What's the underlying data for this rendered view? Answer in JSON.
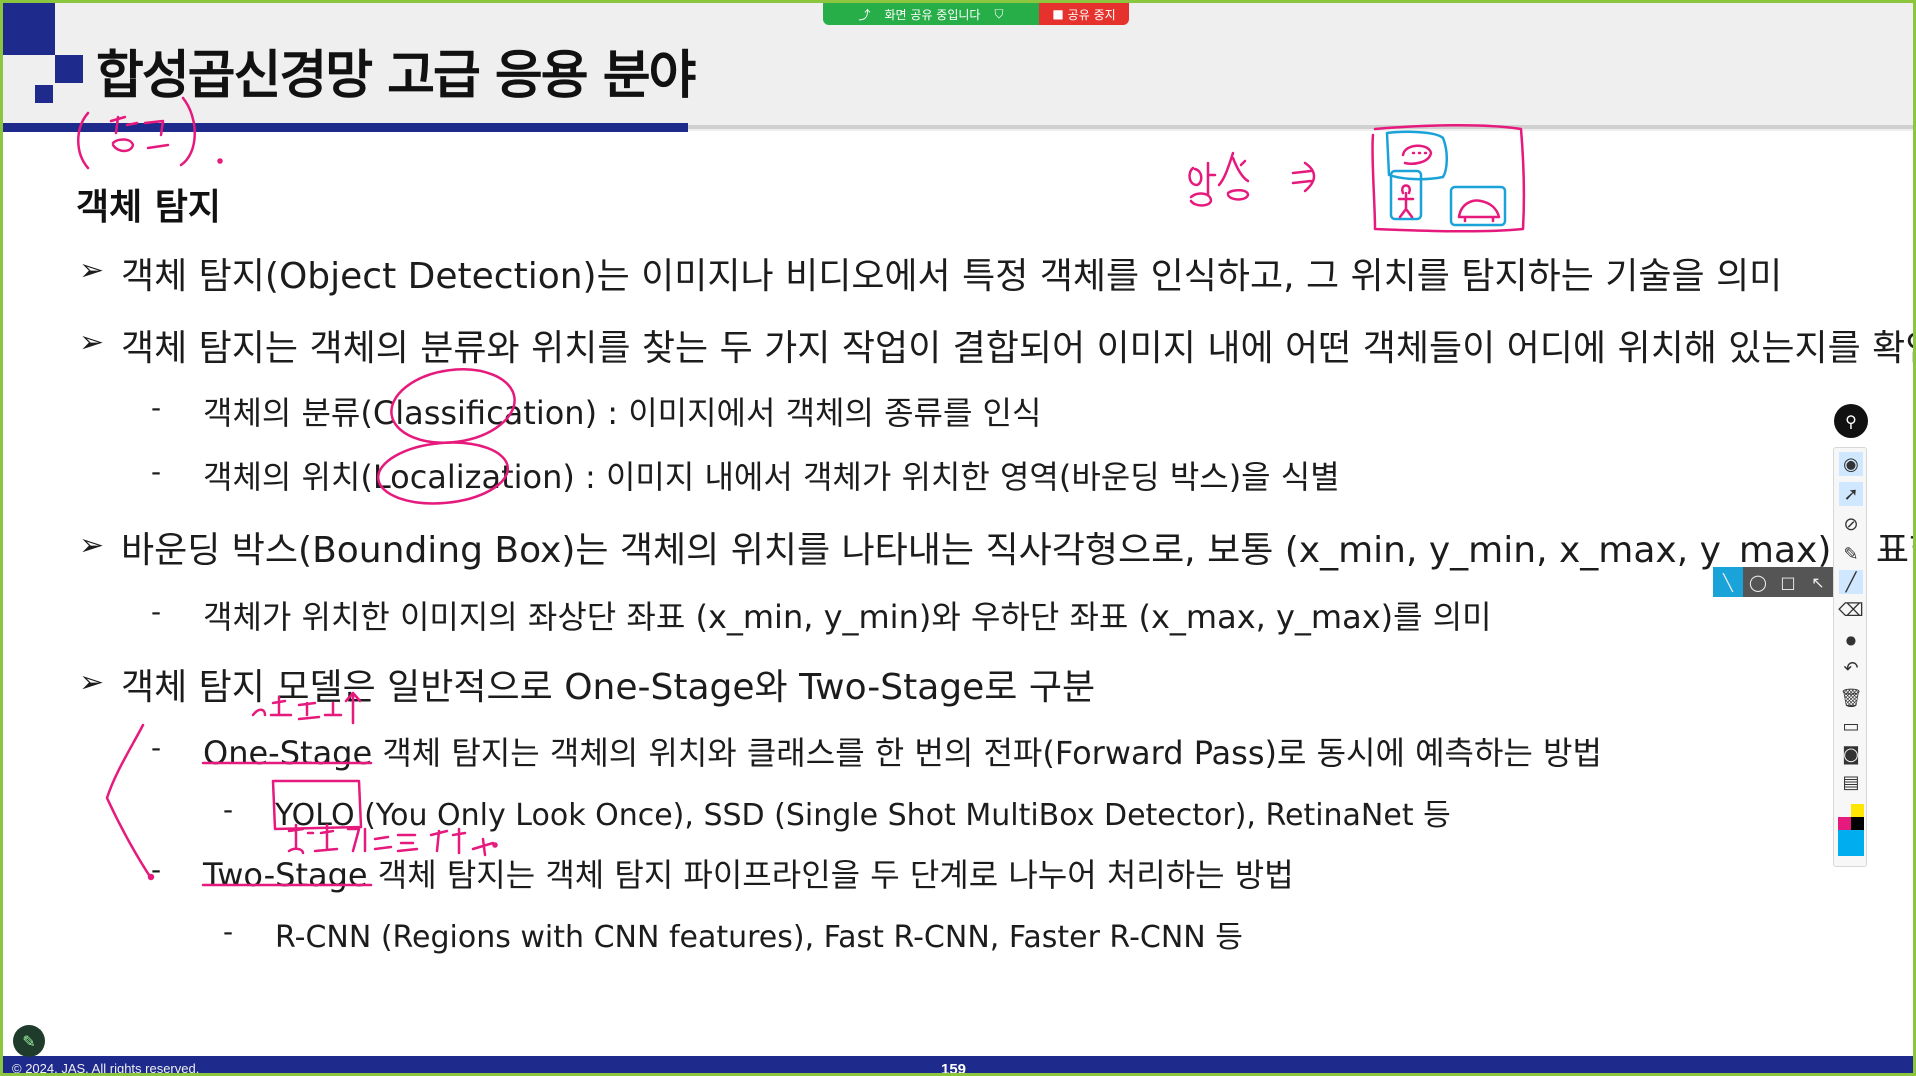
{
  "share_bar": {
    "status_text": "화면 공유 중입니다",
    "stop_label": "공유 중지",
    "colors": {
      "status_bg": "#27ae48",
      "stop_bg": "#e5322d"
    }
  },
  "slide": {
    "title": "합성곱신경망 고급 응용 분야",
    "section_title": "객체 탐지",
    "bullets": [
      "객체 탐지(Object Detection)는 이미지나 비디오에서 특정 객체를 인식하고, 그 위치를 탐지하는 기술을 의미",
      "객체 탐지는 객체의 분류와 위치를 찾는 두 가지 작업이 결합되어 이미지 내에 어떤 객체들이 어디에 위치해 있는지를 확인함",
      "바운딩 박스(Bounding Box)는 객체의 위치를 나타내는 직사각형으로, 보통 (x_min, y_min, x_max, y_max)로 표현",
      "객체 탐지 모델은 일반적으로 One-Stage와 Two-Stage로 구분"
    ],
    "sub_bullets": [
      "객체의 분류(Classification) : 이미지에서 객체의 종류를 인식",
      "객체의 위치(Localization) : 이미지 내에서 객체가 위치한 영역(바운딩 박스)을 식별",
      "객체가 위치한 이미지의 좌상단 좌표 (x_min, y_min)와 우하단 좌표 (x_max, y_max)를 의미",
      "One-Stage 객체 탐지는 객체의 위치와 클래스를 한 번의 전파(Forward Pass)로 동시에 예측하는 방법",
      "Two-Stage 객체 탐지는 객체 탐지 파이프라인을 두 단계로 나누어 처리하는 방법"
    ],
    "sub_sub_bullets": [
      "YOLO (You Only Look Once), SSD (Single Shot MultiBox Detector), RetinaNet 등",
      "R-CNN (Regions with CNN features), Fast R-CNN, Faster R-CNN 등"
    ],
    "bullet_marker": "➢",
    "dash_marker": "-"
  },
  "annotations": {
    "ink_color": "#e6197d",
    "handwritten": [
      "(참고)",
      "영상 ⇒",
      "속도↑",
      "실시간으로 탐지"
    ]
  },
  "toolbar": {
    "icons": [
      "pin-icon",
      "eye-icon",
      "pointer-icon",
      "laser-off-icon",
      "highlighter-icon",
      "pen-icon",
      "eraser-icon",
      "dot-icon",
      "undo-icon",
      "trash-icon",
      "whiteboard-icon",
      "camera-icon",
      "clipboard-icon",
      "color-palette"
    ],
    "palette": [
      "#ffe600",
      "#e6197d",
      "#000000",
      "#00aeef"
    ]
  },
  "footer": {
    "copyright": "© 2024. JAS. All rights reserved.",
    "page_number": "159"
  }
}
